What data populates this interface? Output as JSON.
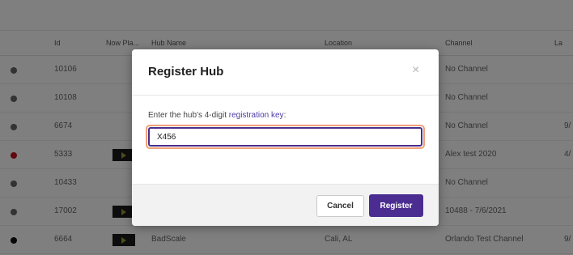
{
  "table": {
    "headers": {
      "id": "Id",
      "now_playing": "Now Pla...",
      "hub_name": "Hub Name",
      "location": "Location",
      "channel": "Channel",
      "last": "La"
    },
    "rows": [
      {
        "status_color": "#666666",
        "id": "10106",
        "hub_name": "",
        "location": "",
        "channel": "No Channel",
        "last": ""
      },
      {
        "status_color": "#666666",
        "id": "10108",
        "hub_name": "",
        "location": "",
        "channel": "No Channel",
        "last": ""
      },
      {
        "status_color": "#666666",
        "id": "6674",
        "hub_name": "",
        "location": "",
        "channel": "No Channel",
        "last": "9/"
      },
      {
        "status_color": "#c0141c",
        "id": "5333",
        "hub_name": "",
        "location": "",
        "channel": "Alex test 2020",
        "last": "4/"
      },
      {
        "status_color": "#666666",
        "id": "10433",
        "hub_name": "",
        "location": "",
        "channel": "No Channel",
        "last": ""
      },
      {
        "status_color": "#666666",
        "id": "17002",
        "hub_name": "",
        "location": "",
        "channel": "10488 - 7/6/2021",
        "last": ""
      },
      {
        "status_color": "#111111",
        "id": "6664",
        "hub_name": "BadScale",
        "location": "Cali, AL",
        "channel": "Orlando Test Channel",
        "last": "9/"
      }
    ]
  },
  "modal": {
    "title": "Register Hub",
    "close_glyph": "×",
    "prompt_prefix": "Enter the hub's 4-digit ",
    "prompt_link": "registration key",
    "prompt_suffix": ":",
    "input_value": "X456",
    "cancel_label": "Cancel",
    "register_label": "Register"
  },
  "colors": {
    "accent": "#4b2d91",
    "focus_ring": "#f0a078",
    "status_offline": "#666666",
    "status_error": "#c0141c"
  }
}
